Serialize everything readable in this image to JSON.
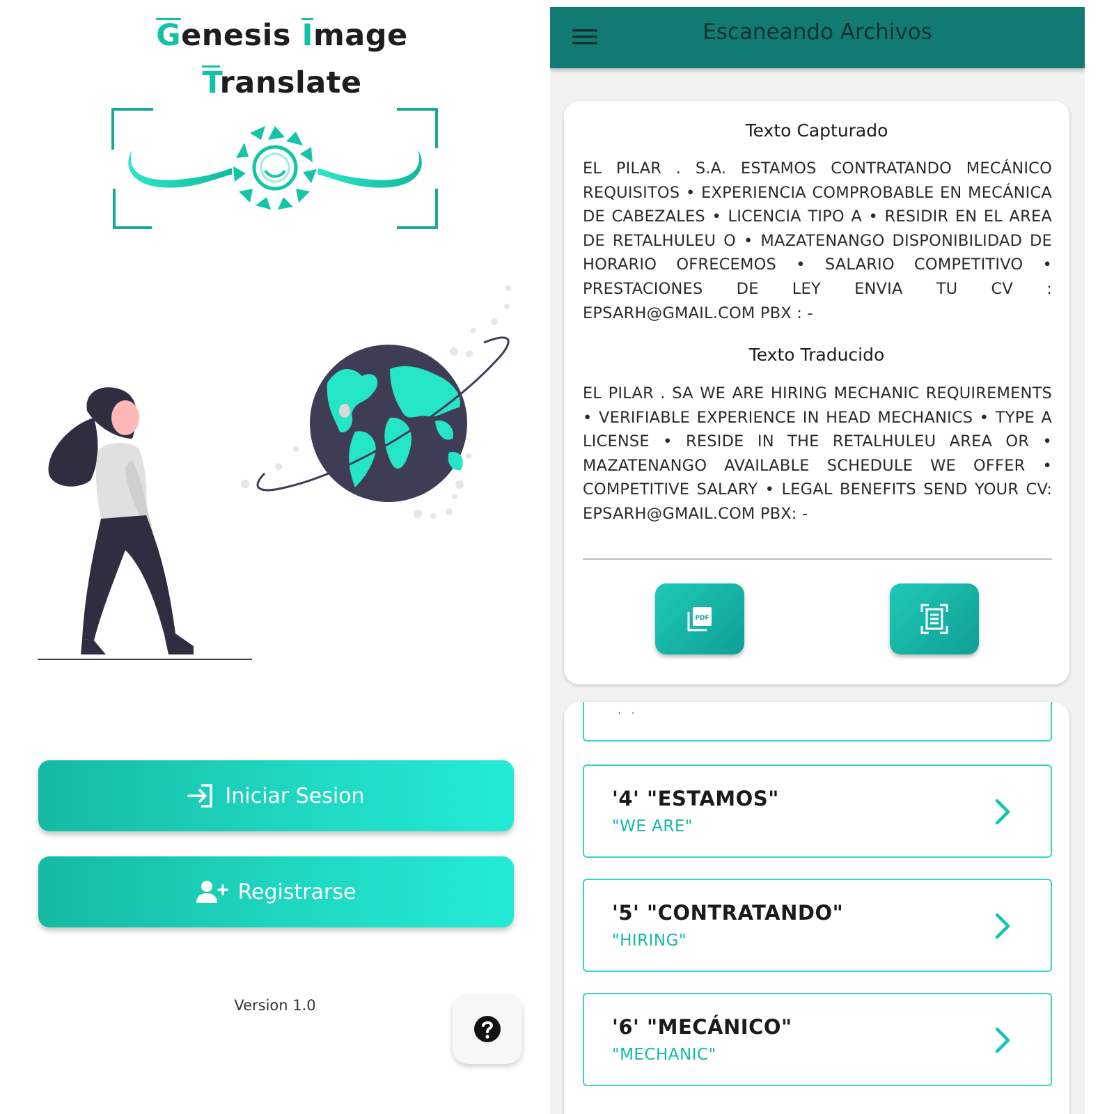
{
  "login_screen": {
    "title": {
      "line1_word1_initial": "G",
      "line1_word1_rest": "enesis",
      "line1_word2_initial": "I",
      "line1_word2_rest": "mage",
      "line2_initial": "T",
      "line2_rest": "ranslate"
    },
    "login_button": {
      "label": "Iniciar Sesion",
      "icon": "login-arrow-icon"
    },
    "register_button": {
      "label": "Registrarse",
      "icon": "add-user-icon"
    },
    "version": "Version 1.0",
    "help_button": {
      "icon": "question-circle-icon"
    }
  },
  "scan_screen": {
    "app_bar": {
      "title": "Escaneando Archivos",
      "menu_icon": "hamburger-menu-icon"
    },
    "captured": {
      "heading": "Texto Capturado",
      "text": "EL PILAR . S.A. ESTAMOS CONTRATANDO MECÁNICO REQUISITOS • EXPERIENCIA COMPROBABLE EN MECÁNICA DE CABEZALES • LICENCIA TIPO A • RESIDIR EN EL AREA DE RETALHULEU O • MAZATENANGO DISPONIBILIDAD DE HORARIO OFRECEMOS • SALARIO COMPETITIVO • PRESTACIONES DE LEY ENVIA TU CV : EPSARH@GMAIL.COM PBX : -"
    },
    "translated": {
      "heading": "Texto Traducido",
      "text": "EL PILAR . SA WE ARE HIRING MECHANIC REQUIREMENTS • VERIFIABLE EXPERIENCE IN HEAD MECHANICS • TYPE A LICENSE • RESIDE IN THE RETALHULEU AREA OR • MAZATENANGO AVAILABLE SCHEDULE WE OFFER • COMPETITIVE SALARY • LEGAL BENEFITS SEND YOUR CV: EPSARH@GMAIL.COM PBX: -"
    },
    "actions": {
      "pdf_icon": "pdf-export-icon",
      "scan_icon": "document-scan-icon"
    },
    "partial_item_text": "· ·",
    "word_list": [
      {
        "original": "'4' \"ESTAMOS\"",
        "translation": "\"WE ARE\""
      },
      {
        "original": "'5' \"CONTRATANDO\"",
        "translation": "\"HIRING\""
      },
      {
        "original": "'6' \"MECÁNICO\"",
        "translation": "\"MECHANIC\""
      }
    ]
  },
  "colors": {
    "accent_teal": "#13c2a6",
    "app_bar": "#117a72",
    "button_gradient_start": "#15b9a2",
    "button_gradient_end": "#22ead6",
    "list_border": "#35d5c4",
    "illustration_dark": "#3f3d56"
  }
}
